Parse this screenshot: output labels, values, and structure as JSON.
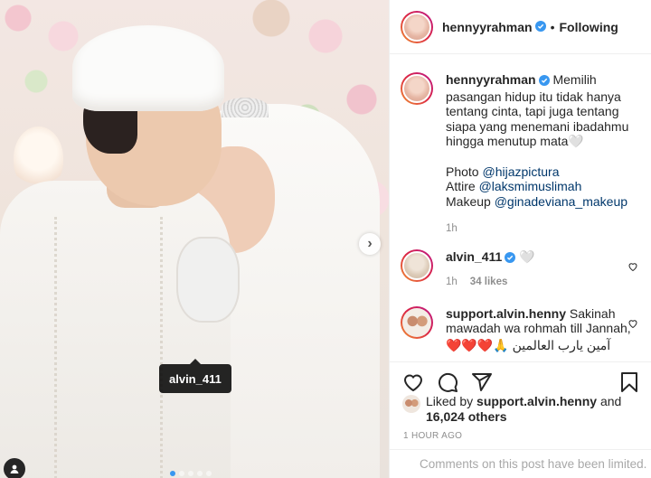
{
  "post": {
    "author": "hennyyrahman",
    "follow_status": "Following",
    "separator": "•"
  },
  "caption": {
    "username": "hennyyrahman",
    "text": "Memilih pasangan hidup itu tidak hanya tentang cinta, tapi juga tentang siapa yang menemani ibadahmu hingga menutup mata🤍",
    "photo_label": "Photo ",
    "photo_credit": "@hijazpictura",
    "attire_label": "Attire ",
    "attire_credit": "@laksmimuslimah",
    "makeup_label": "Makeup ",
    "makeup_credit": "@ginadeviana_makeup",
    "time": "1h"
  },
  "comments": [
    {
      "username": "alvin_411",
      "text": "🤍",
      "time": "1h",
      "likes": "34 likes"
    },
    {
      "username": "support.alvin.henny",
      "text": "Sakinah mawadah wa rohmah till Jannah,",
      "text_arabic": "آمين يارب العالمين 🙏❤️❤️❤️"
    }
  ],
  "photo": {
    "tag_label": "alvin_411",
    "carousel_count": 5,
    "carousel_active": 1
  },
  "likes": {
    "prefix": "Liked by ",
    "liker": "support.alvin.henny",
    "and": " and",
    "others": "16,024 others"
  },
  "timestamp": "1 HOUR AGO",
  "comments_limited": "Comments on this post have been limited.",
  "colors": {
    "verified": "#3897f0",
    "link": "#00376b",
    "muted": "#8e8e8e",
    "tag_bg": "#000000"
  },
  "icons": [
    "verified-badge-icon",
    "heart-icon",
    "comment-icon",
    "share-icon",
    "save-icon",
    "chevron-right-icon",
    "user-tag-icon"
  ]
}
